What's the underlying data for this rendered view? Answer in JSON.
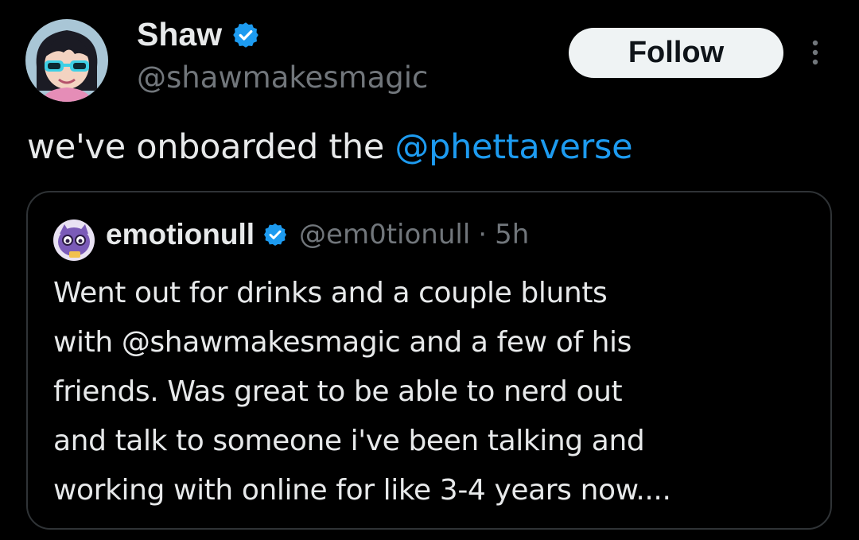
{
  "tweet": {
    "author": {
      "display_name": "Shaw",
      "handle": "@shawmakesmagic",
      "verified": true,
      "avatar_icon": "cartoon-avatar-with-sunglasses"
    },
    "follow_label": "Follow",
    "more_icon": "vertical-ellipsis-icon",
    "text_prefix": "we've onboarded the ",
    "mention": "@phettaverse"
  },
  "quote": {
    "author": {
      "display_name": "emotionull",
      "handle": "@em0tionull",
      "separator": "·",
      "time": "5h",
      "verified": true,
      "avatar_icon": "purple-cartoon-character-avatar"
    },
    "lines": [
      "Went out for drinks and a couple blunts",
      "with @shawmakesmagic and a few of his",
      "friends. Was great to be able to nerd out",
      "and talk to someone i've been talking and",
      "working with online for like 3-4 years now...."
    ]
  },
  "colors": {
    "background": "#000000",
    "text_primary": "#e7e9ea",
    "text_secondary": "#71767b",
    "link": "#1d9bf0",
    "verified_badge": "#1d9bf0",
    "follow_bg": "#eff3f4",
    "border": "#2f3336"
  }
}
